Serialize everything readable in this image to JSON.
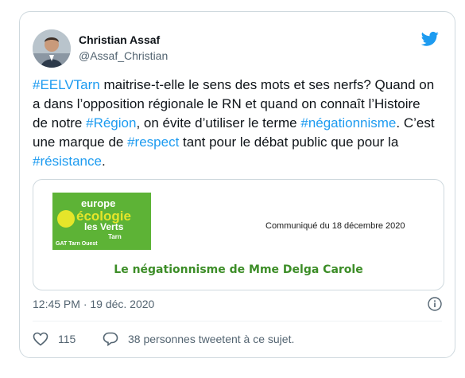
{
  "tweet": {
    "author_name": "Christian Assaf",
    "author_handle": "@Assaf_Christian",
    "text_parts": [
      {
        "t": "#EELVTarn",
        "tag": true
      },
      {
        "t": " maitrise-t-elle le sens des mots et ses nerfs? Quand on a dans l’opposition régionale le RN et quand on connaît l’Histoire de notre ",
        "tag": false
      },
      {
        "t": "#Région",
        "tag": true
      },
      {
        "t": ", on évite d’utiliser le terme ",
        "tag": false
      },
      {
        "t": "#négationnisme",
        "tag": true
      },
      {
        "t": ". C’est une marque de ",
        "tag": false
      },
      {
        "t": "#respect",
        "tag": true
      },
      {
        "t": " tant pour le débat public que pour la ",
        "tag": false
      },
      {
        "t": "#résistance",
        "tag": true
      },
      {
        "t": ".",
        "tag": false
      }
    ],
    "timestamp": "12:45 PM · 19 déc. 2020",
    "likes": "115",
    "retweet_text": "38 personnes tweetent à ce sujet."
  },
  "media": {
    "logo_line1": "europe",
    "logo_line2": "écologie",
    "logo_line3": "les Verts",
    "logo_tarn": "Tarn",
    "logo_gat": "GAT Tarn Ouest",
    "communique": "Communiqué du 18 décembre 2020",
    "headline": "Le négationnisme de Mme Delga Carole"
  },
  "colors": {
    "link": "#1d9bf0",
    "muted": "#536471",
    "eelv_green": "#5db336",
    "eelv_yellow": "#e5e52a"
  },
  "icons": [
    "twitter-bird-icon",
    "info-icon",
    "heart-icon",
    "comment-icon"
  ]
}
